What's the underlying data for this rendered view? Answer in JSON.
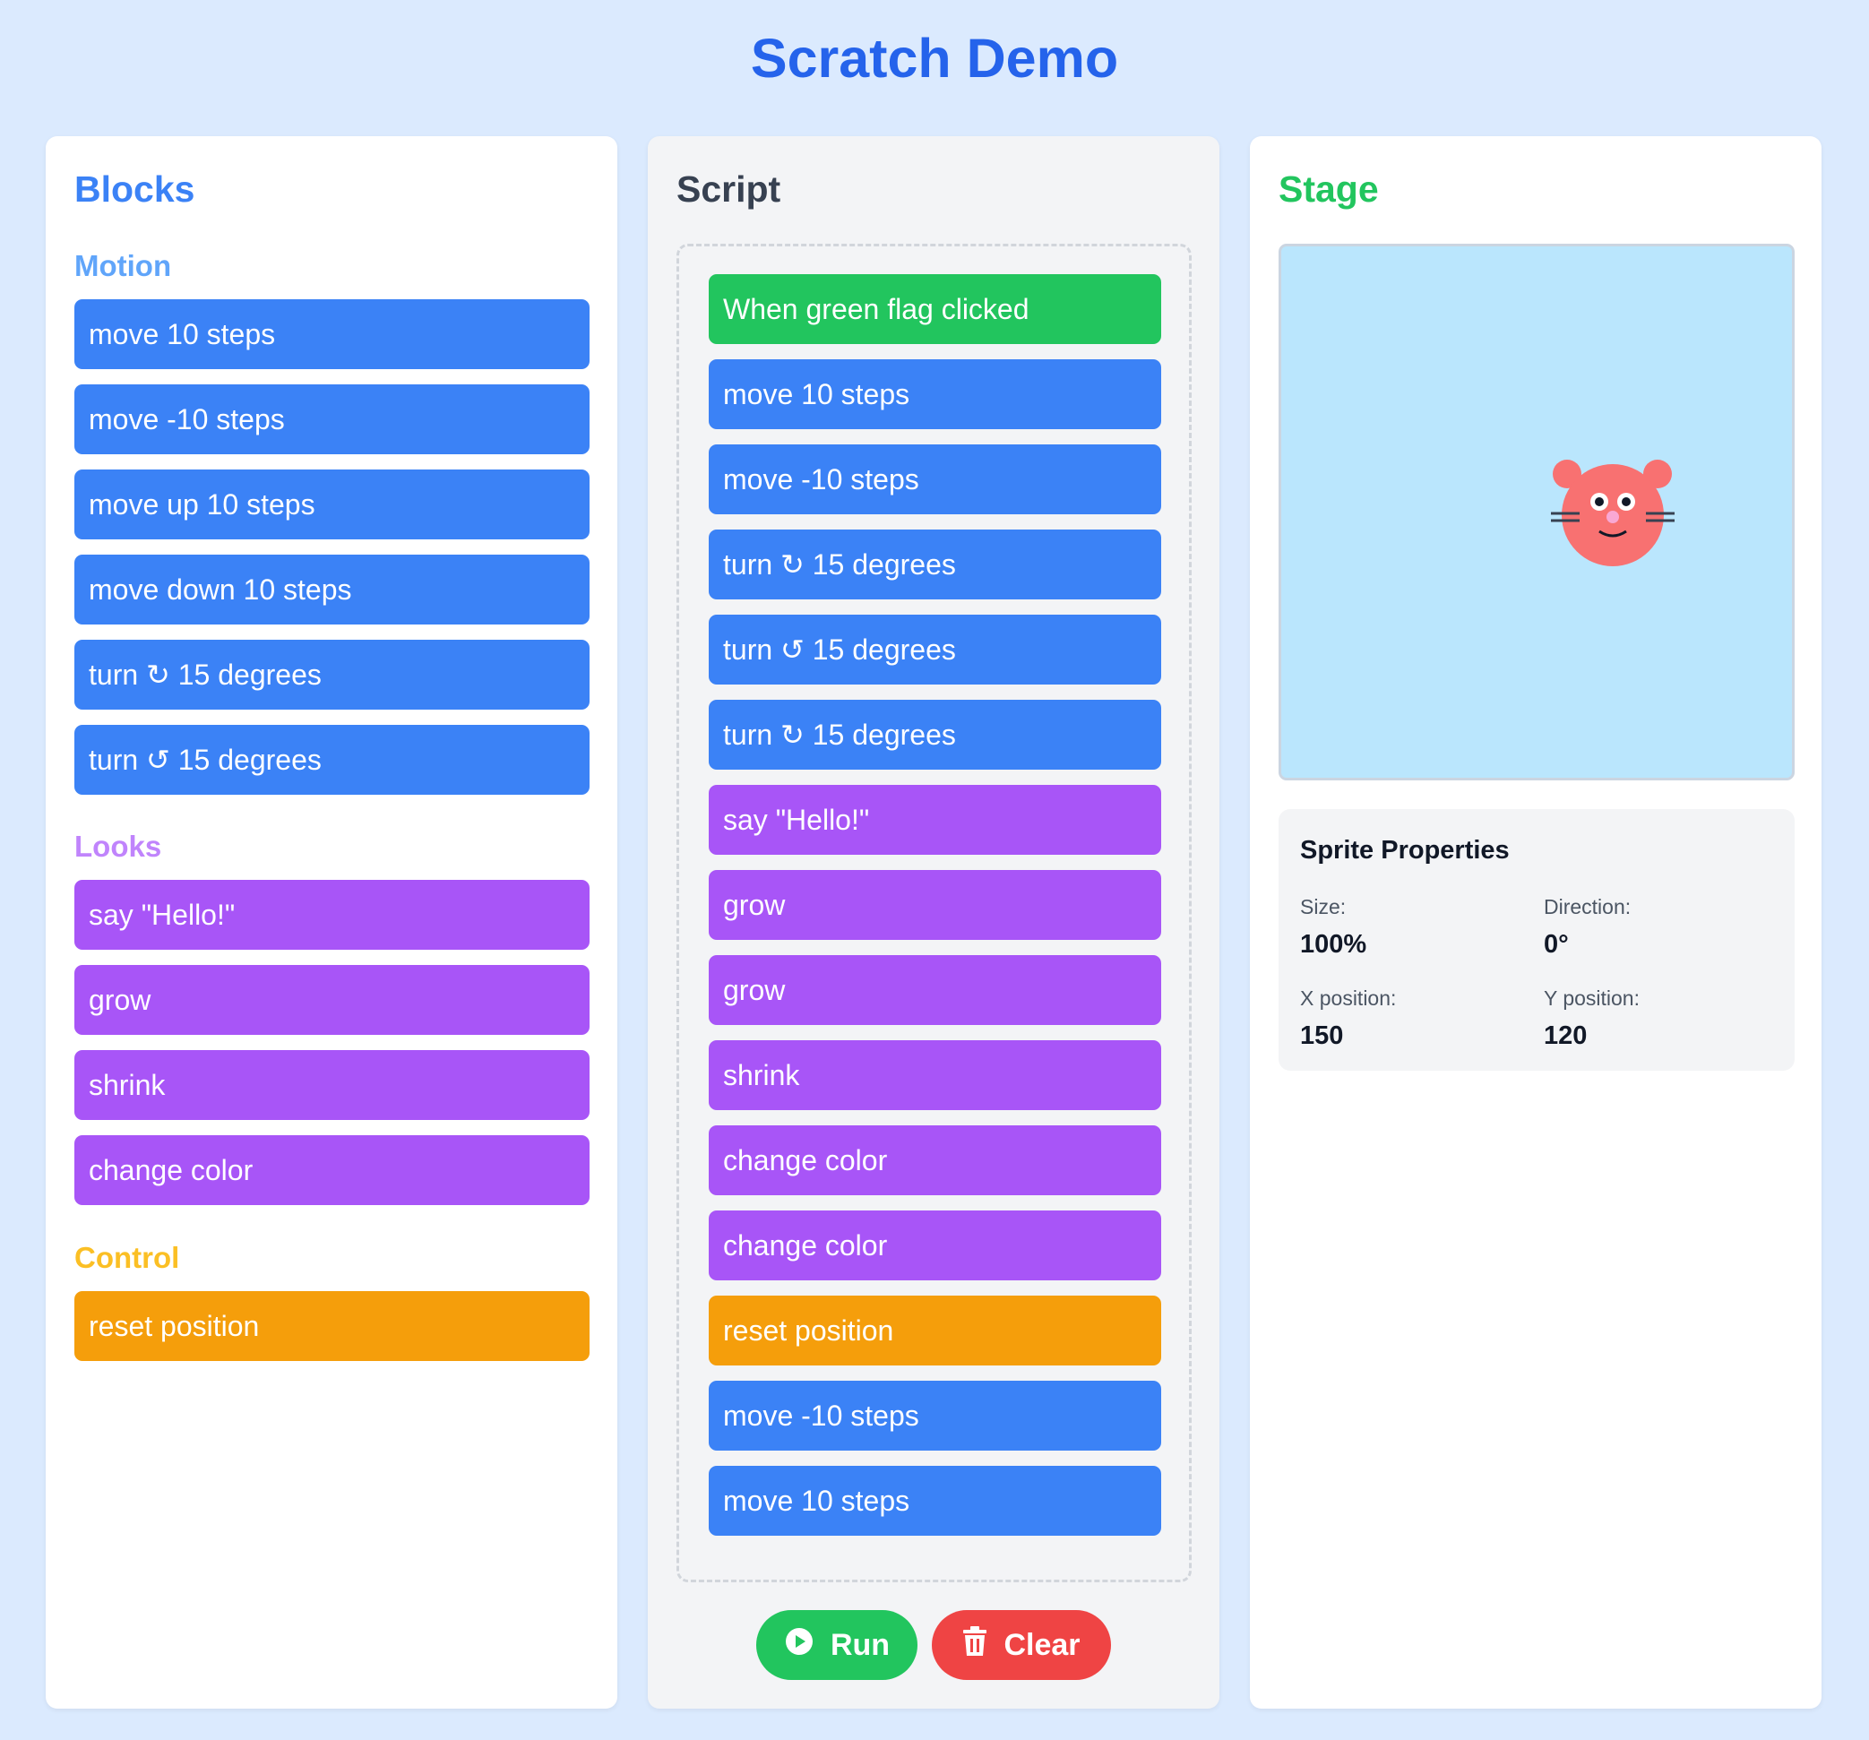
{
  "app": {
    "title": "Scratch Demo"
  },
  "colors": {
    "motion": "#3b82f6",
    "looks": "#a855f7",
    "control": "#f59e0b",
    "event": "#22c55e",
    "run": "#22c55e",
    "clear": "#ef4444"
  },
  "blocks_panel": {
    "title": "Blocks",
    "categories": {
      "motion": {
        "title": "Motion",
        "blocks": [
          "move 10 steps",
          "move -10 steps",
          "move up 10 steps",
          "move down 10 steps",
          "turn ↻ 15 degrees",
          "turn ↺ 15 degrees"
        ]
      },
      "looks": {
        "title": "Looks",
        "blocks": [
          "say \"Hello!\"",
          "grow",
          "shrink",
          "change color"
        ]
      },
      "control": {
        "title": "Control",
        "blocks": [
          "reset position"
        ]
      }
    }
  },
  "script_panel": {
    "title": "Script",
    "blocks": [
      {
        "label": "When green flag clicked",
        "category": "event"
      },
      {
        "label": "move 10 steps",
        "category": "motion"
      },
      {
        "label": "move -10 steps",
        "category": "motion"
      },
      {
        "label": "turn ↻ 15 degrees",
        "category": "motion"
      },
      {
        "label": "turn ↺ 15 degrees",
        "category": "motion"
      },
      {
        "label": "turn ↻ 15 degrees",
        "category": "motion"
      },
      {
        "label": "say \"Hello!\"",
        "category": "looks"
      },
      {
        "label": "grow",
        "category": "looks"
      },
      {
        "label": "grow",
        "category": "looks"
      },
      {
        "label": "shrink",
        "category": "looks"
      },
      {
        "label": "change color",
        "category": "looks"
      },
      {
        "label": "change color",
        "category": "looks"
      },
      {
        "label": "reset position",
        "category": "control"
      },
      {
        "label": "move -10 steps",
        "category": "motion"
      },
      {
        "label": "move 10 steps",
        "category": "motion"
      }
    ],
    "run_label": "Run",
    "clear_label": "Clear",
    "run_icon": "play-circle-icon",
    "clear_icon": "trash-icon"
  },
  "stage_panel": {
    "title": "Stage",
    "sprite_icon": "mouse-sprite-icon",
    "properties": {
      "title": "Sprite Properties",
      "size_label": "Size:",
      "size_value": "100%",
      "direction_label": "Direction:",
      "direction_value": "0°",
      "x_label": "X position:",
      "x_value": "150",
      "y_label": "Y position:",
      "y_value": "120"
    }
  }
}
